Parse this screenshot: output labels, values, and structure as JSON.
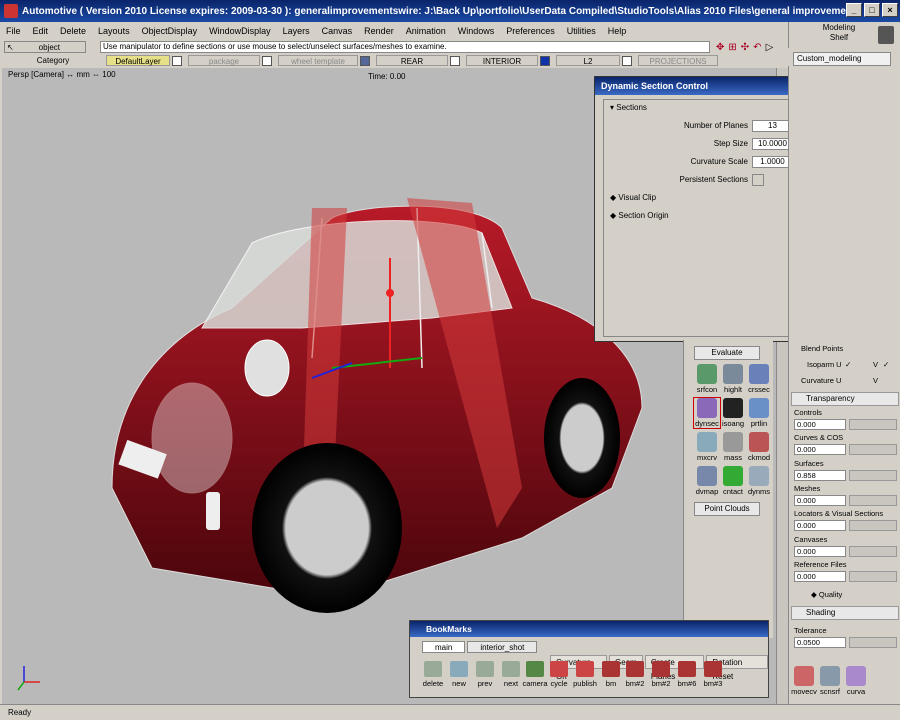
{
  "window": {
    "title": "Automotive ( Version 2010  License expires: 2009-03-30 ): generalimprovementswire: J:\\Back Up\\portfolio\\UserData Compiled\\StudioTools\\Alias 2010 Files\\general improvements.wire"
  },
  "menu": [
    "File",
    "Edit",
    "Delete",
    "Layouts",
    "ObjectDisplay",
    "WindowDisplay",
    "Layers",
    "Canvas",
    "Render",
    "Animation",
    "Windows",
    "Preferences",
    "Utilities",
    "Help"
  ],
  "shelf": {
    "line1": "Modeling",
    "line2": "Shelf",
    "tab": "Custom_modeling"
  },
  "toolbar": {
    "pick_mode": "object",
    "message": "Use manipulator to define sections or use mouse to select/unselect surfaces/meshes to examine."
  },
  "layers": {
    "category_label": "Category",
    "items": [
      "DefaultLayer",
      "package",
      "wheel template",
      "REAR",
      "INTERIOR",
      "L2",
      "PROJECTIONS"
    ]
  },
  "viewport": {
    "camera_label": "Persp [Camera]",
    "units": "mm",
    "zoom": "100",
    "time": "Time: 0.00"
  },
  "dialog": {
    "title": "Dynamic Section Control",
    "sections_header": "Sections",
    "number_of_planes_label": "Number of Planes",
    "number_of_planes": "13",
    "step_size_label": "Step Size",
    "step_size": "10.0000",
    "curvature_scale_label": "Curvature Scale",
    "curvature_scale": "1.0000",
    "persistent_label": "Persistent Sections",
    "visual_clip": "Visual Clip",
    "section_origin": "Section Origin"
  },
  "evaluate": {
    "header": "Evaluate",
    "tools": [
      "srfcon",
      "highlt",
      "crssec",
      "dynsec",
      "isoang",
      "prtlin",
      "mxcrv",
      "mass",
      "ckmod",
      "dvmap",
      "cntact",
      "dynms"
    ],
    "footer": "Point Clouds"
  },
  "right_panel": {
    "blend_points": "Blend Points",
    "isoparm_u": "Isoparm U",
    "curvature_u": "Curvature U",
    "v": "V",
    "transparency": "Transparency",
    "controls_label": "Controls",
    "controls": "0.000",
    "curves_label": "Curves & COS",
    "curves": "0.000",
    "surfaces_label": "Surfaces",
    "surfaces": "0.858",
    "meshes_label": "Meshes",
    "meshes": "0.000",
    "locators_label": "Locators & Visual Sections",
    "locators": "0.000",
    "canvases_label": "Canvases",
    "canvases": "0.000",
    "reference_label": "Reference Files",
    "reference": "0.000",
    "quality": "Quality",
    "shading": "Shading",
    "tolerance_label": "Tolerance",
    "tolerance": "0.0500",
    "tools": [
      "movecv",
      "scnsrf",
      "curva"
    ]
  },
  "bookmarks": {
    "title": "BookMarks",
    "tabs": [
      "main",
      "interior_shot"
    ],
    "buttons": [
      "Curvature On",
      "Geom",
      "Create Planes",
      "Rotation Reset"
    ],
    "items": [
      "delete",
      "new",
      "prev",
      "next",
      "camera",
      "cycle",
      "publish",
      "bm",
      "bm#2",
      "bm#2",
      "bm#6",
      "bm#3"
    ]
  },
  "status": "Ready",
  "colors": {
    "car_body": "#8a0d18",
    "section_red": "#cc2020",
    "viewport_bg": "#b9b9b9",
    "titlebar": "#0a246a"
  }
}
